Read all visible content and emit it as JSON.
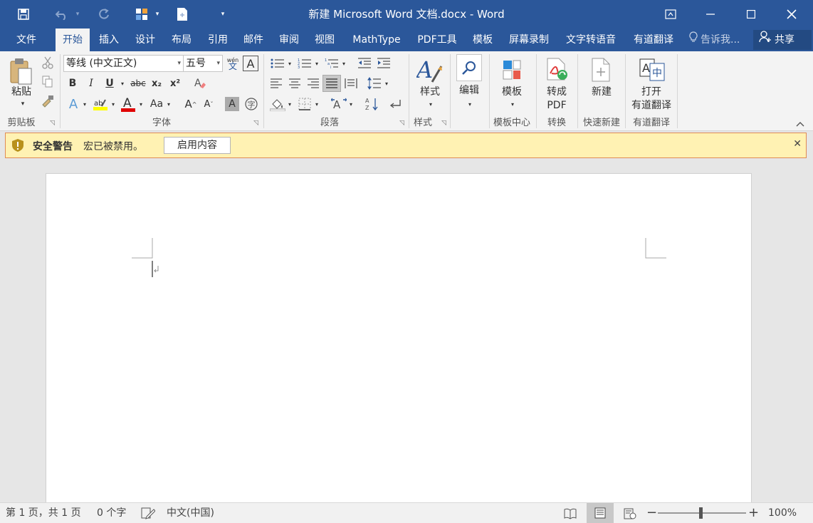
{
  "window": {
    "title": "新建 Microsoft Word 文档.docx - Word",
    "accent_color": "#2b579a"
  },
  "qat": {
    "save_icon": "save-icon",
    "undo_icon": "undo-icon",
    "redo_icon": "redo-icon"
  },
  "tabs": {
    "file": "文件",
    "home": "开始",
    "insert": "插入",
    "design": "设计",
    "layout": "布局",
    "references": "引用",
    "mailings": "邮件",
    "review": "审阅",
    "view": "视图",
    "mathtype": "MathType",
    "pdf": "PDF工具",
    "template": "模板",
    "screenrec": "屏幕录制",
    "tts": "文字转语音",
    "youdao": "有道翻译"
  },
  "tellme": "告诉我...",
  "share": "共享",
  "ribbon": {
    "clipboard": {
      "paste": "粘贴",
      "label": "剪贴板"
    },
    "font": {
      "name": "等线 (中文正文)",
      "size": "五号",
      "bold": "B",
      "italic": "I",
      "underline": "U",
      "strike": "abc",
      "subscript": "x₂",
      "superscript": "x²",
      "case": "Aa",
      "label": "字体",
      "phonetic": "wén",
      "phonetic_char": "文",
      "highlight_color": "#ffff00",
      "font_color": "#e00000"
    },
    "paragraph": {
      "label": "段落"
    },
    "styles": {
      "big": "样式",
      "label": "样式"
    },
    "editing": {
      "big": "编辑"
    },
    "template_center": {
      "big": "模板",
      "label": "模板中心"
    },
    "convert": {
      "big": "转成",
      "big2": "PDF",
      "label": "转换"
    },
    "quicknew": {
      "big": "新建",
      "label": "快速新建"
    },
    "youdao": {
      "big": "打开",
      "big2": "有道翻译",
      "label": "有道翻译"
    }
  },
  "security": {
    "title": "安全警告",
    "message": "宏已被禁用。",
    "button": "启用内容"
  },
  "status": {
    "page": "第 1 页，共 1 页",
    "words": "0 个字",
    "language": "中文(中国)",
    "zoom": "100%",
    "zoom_level": 100
  }
}
